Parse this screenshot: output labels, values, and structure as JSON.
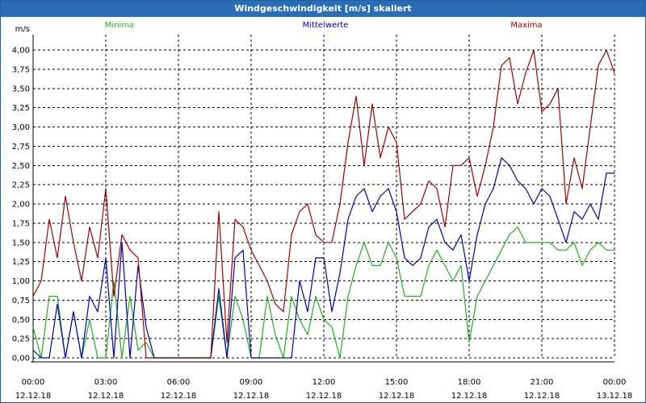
{
  "window": {
    "title": "Windgeschwindigkeit [m/s] skaliert"
  },
  "colors": {
    "titlebar": "#2a6db5",
    "min": "#20b020",
    "mean": "#0000b4",
    "max": "#a00000"
  },
  "chart_data": {
    "type": "line",
    "title": "Windgeschwindigkeit [m/s] skaliert",
    "ylabel": "m/s",
    "ylim": [
      0,
      4.2
    ],
    "xlim": [
      "12.12.18 00:00",
      "13.12.18 00:00"
    ],
    "grid": true,
    "legend": [
      "Minima",
      "Mittelwerte",
      "Maxima"
    ],
    "yticks": [
      "0,00",
      "0,25",
      "0,50",
      "0,75",
      "1,00",
      "1,25",
      "1,50",
      "1,75",
      "2,00",
      "2,25",
      "2,50",
      "2,75",
      "3,00",
      "3,25",
      "3,50",
      "3,75",
      "4,00"
    ],
    "xticks": [
      {
        "time": "00:00",
        "date": "12.12.18"
      },
      {
        "time": "03:00",
        "date": "12.12.18"
      },
      {
        "time": "06:00",
        "date": "12.12.18"
      },
      {
        "time": "09:00",
        "date": "12.12.18"
      },
      {
        "time": "12:00",
        "date": "12.12.18"
      },
      {
        "time": "15:00",
        "date": "12.12.18"
      },
      {
        "time": "18:00",
        "date": "12.12.18"
      },
      {
        "time": "21:00",
        "date": "12.12.18"
      },
      {
        "time": "00:00",
        "date": "13.12.18"
      }
    ],
    "x": [
      "00:00",
      "00:20",
      "00:40",
      "01:00",
      "01:20",
      "01:40",
      "02:00",
      "02:20",
      "02:40",
      "03:00",
      "03:20",
      "03:40",
      "04:00",
      "04:20",
      "04:40",
      "05:00",
      "05:20",
      "05:40",
      "06:00",
      "06:20",
      "06:40",
      "07:00",
      "07:20",
      "07:40",
      "08:00",
      "08:20",
      "08:40",
      "09:00",
      "09:20",
      "09:40",
      "10:00",
      "10:20",
      "10:40",
      "11:00",
      "11:20",
      "11:40",
      "12:00",
      "12:20",
      "12:40",
      "13:00",
      "13:20",
      "13:40",
      "14:00",
      "14:20",
      "14:40",
      "15:00",
      "15:20",
      "15:40",
      "16:00",
      "16:20",
      "16:40",
      "17:00",
      "17:20",
      "17:40",
      "18:00",
      "18:20",
      "18:40",
      "19:00",
      "19:20",
      "19:40",
      "20:00",
      "20:20",
      "20:40",
      "21:00",
      "21:20",
      "21:40",
      "22:00",
      "22:20",
      "22:40",
      "23:00",
      "23:20",
      "23:40",
      "24:00"
    ],
    "series": [
      {
        "name": "Minima",
        "color": "#20b020",
        "values": [
          0.4,
          0.0,
          0.8,
          0.8,
          0.0,
          0.6,
          0.0,
          0.5,
          0.0,
          0.0,
          1.0,
          0.0,
          0.8,
          0.1,
          0.2,
          0.0,
          0.0,
          0.0,
          0.0,
          0.0,
          0.0,
          0.0,
          0.0,
          0.8,
          0.0,
          0.8,
          0.5,
          0.0,
          0.0,
          0.8,
          0.3,
          0.0,
          0.8,
          0.5,
          0.3,
          0.8,
          0.5,
          0.4,
          0.0,
          0.8,
          1.2,
          1.5,
          1.2,
          1.2,
          1.5,
          1.3,
          0.8,
          0.8,
          0.8,
          1.2,
          1.4,
          1.2,
          1.0,
          1.2,
          0.2,
          0.8,
          1.0,
          1.2,
          1.4,
          1.6,
          1.7,
          1.5,
          1.5,
          1.5,
          1.5,
          1.4,
          1.4,
          1.5,
          1.2,
          1.4,
          1.5,
          1.4,
          1.4
        ]
      },
      {
        "name": "Mittelwerte",
        "color": "#0000b4",
        "values": [
          0.1,
          0.0,
          0.0,
          0.7,
          0.0,
          0.6,
          0.0,
          0.8,
          0.6,
          1.3,
          0.0,
          1.5,
          0.0,
          1.2,
          0.4,
          0.0,
          0.0,
          0.0,
          0.0,
          0.0,
          0.0,
          0.0,
          0.0,
          0.9,
          0.0,
          1.3,
          1.4,
          0.0,
          0.0,
          0.0,
          0.0,
          0.0,
          0.0,
          1.0,
          0.6,
          1.3,
          1.3,
          0.6,
          1.1,
          1.8,
          2.1,
          2.2,
          1.9,
          2.1,
          2.2,
          1.9,
          1.3,
          1.2,
          1.3,
          1.7,
          1.8,
          1.5,
          1.4,
          1.6,
          1.0,
          1.6,
          2.0,
          2.2,
          2.6,
          2.5,
          2.3,
          2.2,
          2.0,
          2.2,
          2.1,
          1.8,
          1.5,
          1.9,
          1.8,
          2.0,
          1.8,
          2.4,
          2.4
        ]
      },
      {
        "name": "Maxima",
        "color": "#a00000",
        "values": [
          0.8,
          1.0,
          1.8,
          1.3,
          2.1,
          1.5,
          1.0,
          1.7,
          1.3,
          2.2,
          0.8,
          1.6,
          1.4,
          1.3,
          0.0,
          0.0,
          0.0,
          0.0,
          0.0,
          0.0,
          0.0,
          0.0,
          0.0,
          1.9,
          0.2,
          1.8,
          1.7,
          1.4,
          1.2,
          1.0,
          0.7,
          0.6,
          1.6,
          1.9,
          2.0,
          1.6,
          1.5,
          1.5,
          2.0,
          2.8,
          3.4,
          2.5,
          3.3,
          2.6,
          3.0,
          2.8,
          1.8,
          1.9,
          2.0,
          2.3,
          2.2,
          1.7,
          2.5,
          2.5,
          2.6,
          2.1,
          2.5,
          3.0,
          3.8,
          3.9,
          3.3,
          3.7,
          4.0,
          3.2,
          3.3,
          3.5,
          2.0,
          2.6,
          2.2,
          3.0,
          3.8,
          4.0,
          3.7
        ]
      }
    ]
  }
}
